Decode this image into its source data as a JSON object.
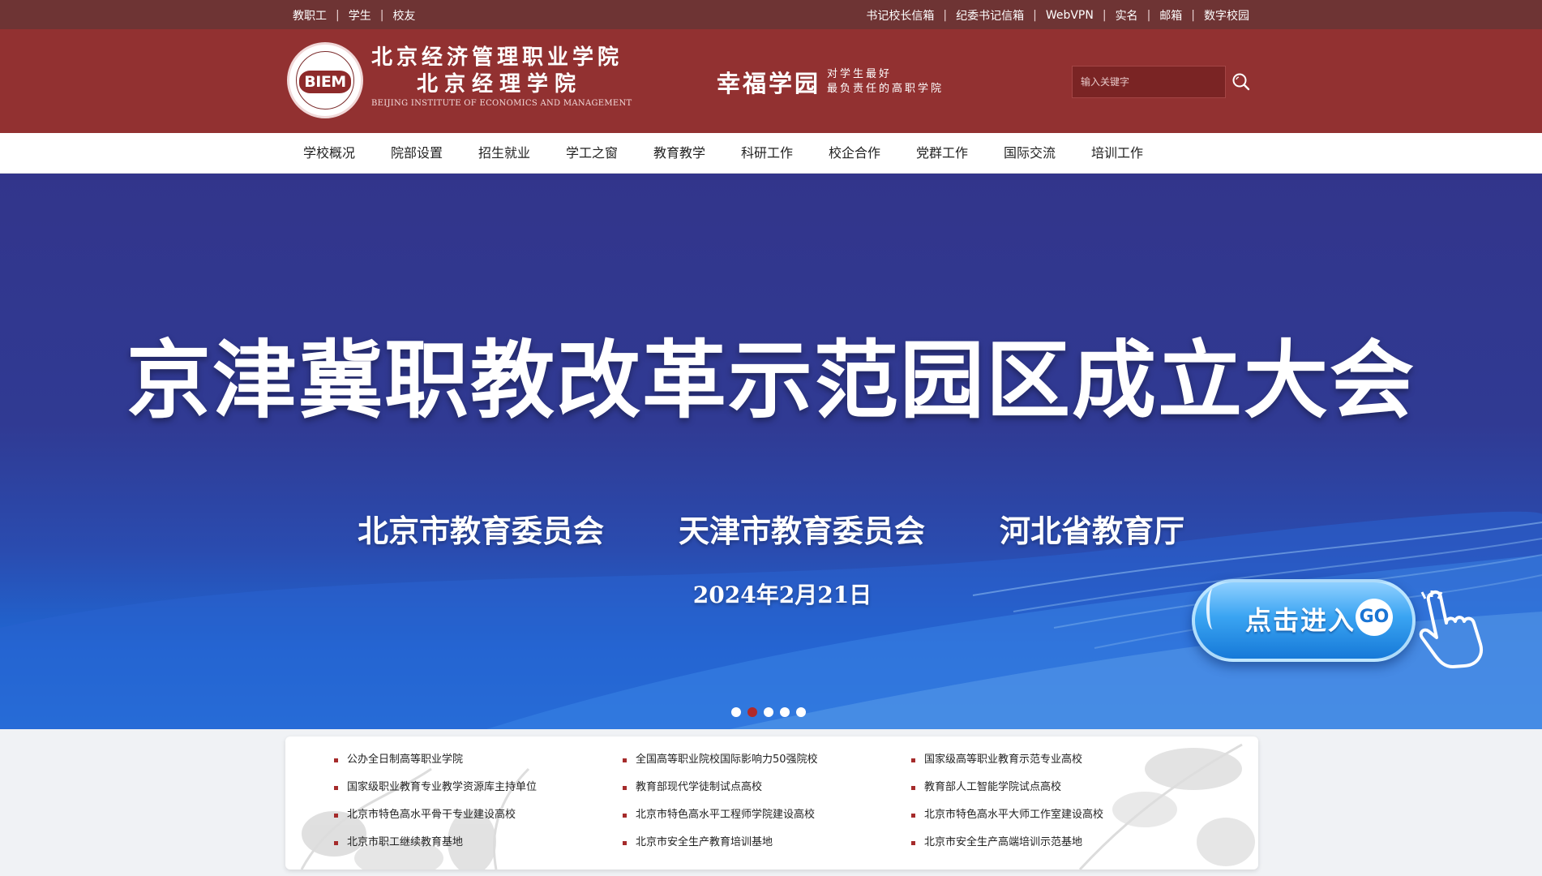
{
  "topbar": {
    "left_links": [
      "教职工",
      "学生",
      "校友"
    ],
    "right_links": [
      "书记校长信箱",
      "纪委书记信箱",
      "WebVPN",
      "实名",
      "邮箱",
      "数字校园"
    ]
  },
  "header": {
    "logo_mark": "BIEM",
    "name_line1": "北京经济管理职业学院",
    "name_line2": "北京经理学院",
    "name_en": "BEIJING INSTITUTE OF ECONOMICS AND MANAGEMENT",
    "slogan_big": "幸福学园",
    "slogan_line1": "对学生最好",
    "slogan_line2": "最负责任的高职学院",
    "search_placeholder": "输入关键字",
    "search_icon": "search-icon"
  },
  "nav": {
    "items": [
      "学校概况",
      "院部设置",
      "招生就业",
      "学工之窗",
      "教育教学",
      "科研工作",
      "校企合作",
      "党群工作",
      "国际交流",
      "培训工作"
    ]
  },
  "hero": {
    "title": "京津冀职教改革示范园区成立大会",
    "orgs": [
      "北京市教育委员会",
      "天津市教育委员会",
      "河北省教育厅"
    ],
    "date": "2024年2月21日",
    "enter_label": "点击进入",
    "go_label": "GO",
    "slide_count": 5,
    "active_slide": 2
  },
  "honors": [
    "公办全日制高等职业学院",
    "全国高等职业院校国际影响力50强院校",
    "国家级高等职业教育示范专业高校",
    "国家级职业教育专业教学资源库主持单位",
    "教育部现代学徒制试点高校",
    "教育部人工智能学院试点高校",
    "北京市特色高水平骨干专业建设高校",
    "北京市特色高水平工程师学院建设高校",
    "北京市特色高水平大师工作室建设高校",
    "北京市职工继续教育基地",
    "北京市安全生产教育培训基地",
    "北京市安全生产高端培训示范基地"
  ],
  "colors": {
    "topbar": "#6e3434",
    "header": "#923131",
    "accent": "#a52b2b",
    "hero_top": "#32358b",
    "hero_bottom": "#2477e0"
  }
}
